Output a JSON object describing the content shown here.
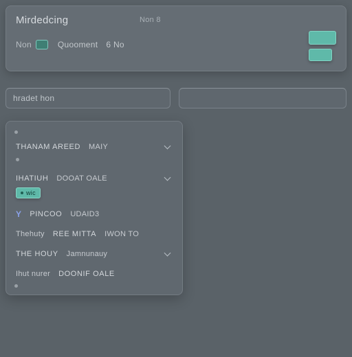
{
  "header": {
    "title": "Mirdedcing",
    "subtitle": "Non 8",
    "row": {
      "left": "Non",
      "mid": "Quooment",
      "right": "6 No"
    }
  },
  "search": {
    "placeholder": "hradet hon"
  },
  "list": {
    "items": [
      {
        "a": "THANAM AREED",
        "b": "MAIY",
        "chev": true
      },
      {
        "a": "IHATIUH",
        "b": "DOOAT OALE",
        "chev": true,
        "tag": "wic"
      },
      {
        "a": "PINCOO",
        "b": "UDAID3",
        "prefix": "Y",
        "chev": false
      },
      {
        "a": "Thehuty",
        "b": "REE MITTA",
        "suffix": "IWON TO",
        "chev": false
      },
      {
        "a": "THE HOUY",
        "b": "Jamnunauy",
        "chev": true
      },
      {
        "a": "Ihut nurer",
        "b": "DOONIF OALE",
        "chev": false
      }
    ]
  },
  "colors": {
    "accent": "#5fb9a9"
  }
}
